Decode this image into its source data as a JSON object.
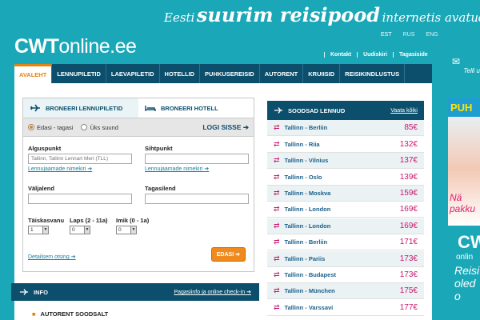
{
  "tagline": {
    "prefix": "Eesti",
    "highlight": "suurim reisipood",
    "suffix": "internetis avatud!"
  },
  "logo": {
    "bold": "CWT",
    "rest": "online.ee"
  },
  "languages": [
    "EST",
    "RUS",
    "ENG"
  ],
  "toplinks": [
    "Kontakt",
    "Uudiskiri",
    "Tagasiside"
  ],
  "nav": [
    "AVALEHT",
    "LENNUPILETID",
    "LAEVAPILETID",
    "HOTELLID",
    "PUHKUSEREISID",
    "AUTORENT",
    "KRUIISID",
    "REISIKINDLUSTUS"
  ],
  "booking": {
    "tab_flight": "BRONEERI LENNUPILETID",
    "tab_hotel": "BRONEERI HOTELL",
    "radio_roundtrip": "Edasi - tagasi",
    "radio_oneway": "Üks suund",
    "login": "LOGI SISSE",
    "origin_label": "Alguspunkt",
    "origin_placeholder": "Tallinn, Tallinn Lennart Meri (TLL)",
    "origin_link": "Lennujaamade nimekiri",
    "dest_label": "Sihtpunkt",
    "dest_link": "Lennujaamade nimekiri",
    "depart_label": "Väljalend",
    "return_label": "Tagasilend",
    "adults_label": "Täiskasvanu",
    "adults_value": "1",
    "children_label": "Laps (2 - 11a)",
    "children_value": "0",
    "infants_label": "Imik (0 - 1a)",
    "infants_value": "0",
    "detail_link": "Detailsem otsing",
    "submit": "EDASI"
  },
  "info": {
    "title": "INFO",
    "link": "Pagasiinfo ja online check-in"
  },
  "autorent": "AUTORENT SOODSALT",
  "deals": {
    "title": "SOODSAD LENNUD",
    "link": "Vaata kõiki",
    "rows": [
      {
        "route": "Tallinn - Berliin",
        "price": "85€"
      },
      {
        "route": "Tallinn - Riia",
        "price": "132€"
      },
      {
        "route": "Tallinn - Vilnius",
        "price": "137€"
      },
      {
        "route": "Tallinn - Oslo",
        "price": "139€"
      },
      {
        "route": "Tallinn - Moskva",
        "price": "159€"
      },
      {
        "route": "Tallinn - London",
        "price": "169€"
      },
      {
        "route": "Tallinn - London",
        "price": "169€"
      },
      {
        "route": "Tallinn - Berliin",
        "price": "171€"
      },
      {
        "route": "Tallinn - Pariis",
        "price": "173€"
      },
      {
        "route": "Tallinn - Budapest",
        "price": "173€"
      },
      {
        "route": "Tallinn - München",
        "price": "175€"
      },
      {
        "route": "Tallinn - Varssavi",
        "price": "177€"
      }
    ]
  },
  "ad": {
    "top": "Telli u",
    "banner": "PUH",
    "pink": "Nä",
    "pink2": "pakku",
    "brand": "CWT",
    "brand_sub": "onlin",
    "line1": "Reisi",
    "line2": "oled o"
  },
  "colors": {
    "bg": "#1aa8b8",
    "nav": "#0b4f6c",
    "accent": "#e8820e",
    "price": "#c8186e"
  }
}
